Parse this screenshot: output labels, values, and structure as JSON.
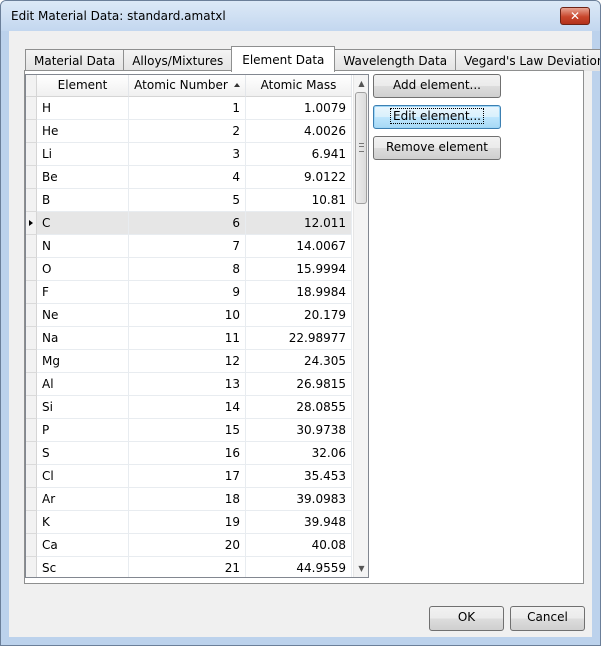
{
  "window": {
    "title": "Edit Material Data: standard.amatxl",
    "close_label": "✕"
  },
  "tabs": [
    {
      "label": "Material Data",
      "key": "M",
      "active": false
    },
    {
      "label": "Alloys/Mixtures",
      "key": "o",
      "active": false
    },
    {
      "label": "Element Data",
      "key": "E",
      "active": true
    },
    {
      "label": "Wavelength Data",
      "key": "W",
      "active": false
    },
    {
      "label": "Vegard's Law Deviation",
      "key": "",
      "active": false
    }
  ],
  "grid": {
    "columns": [
      "Element",
      "Atomic Number",
      "Atomic Mass"
    ],
    "sorted_column": "Atomic Number",
    "selected_row": 5,
    "rows": [
      [
        "H",
        "1",
        "1.0079"
      ],
      [
        "He",
        "2",
        "4.0026"
      ],
      [
        "Li",
        "3",
        "6.941"
      ],
      [
        "Be",
        "4",
        "9.0122"
      ],
      [
        "B",
        "5",
        "10.81"
      ],
      [
        "C",
        "6",
        "12.011"
      ],
      [
        "N",
        "7",
        "14.0067"
      ],
      [
        "O",
        "8",
        "15.9994"
      ],
      [
        "F",
        "9",
        "18.9984"
      ],
      [
        "Ne",
        "10",
        "20.179"
      ],
      [
        "Na",
        "11",
        "22.98977"
      ],
      [
        "Mg",
        "12",
        "24.305"
      ],
      [
        "Al",
        "13",
        "26.9815"
      ],
      [
        "Si",
        "14",
        "28.0855"
      ],
      [
        "P",
        "15",
        "30.9738"
      ],
      [
        "S",
        "16",
        "32.06"
      ],
      [
        "Cl",
        "17",
        "35.453"
      ],
      [
        "Ar",
        "18",
        "39.0983"
      ],
      [
        "K",
        "19",
        "39.948"
      ],
      [
        "Ca",
        "20",
        "40.08"
      ],
      [
        "Sc",
        "21",
        "44.9559"
      ]
    ]
  },
  "buttons": {
    "add": "Add element...",
    "edit": "Edit element...",
    "remove": "Remove element",
    "ok": "OK",
    "cancel": "Cancel"
  }
}
